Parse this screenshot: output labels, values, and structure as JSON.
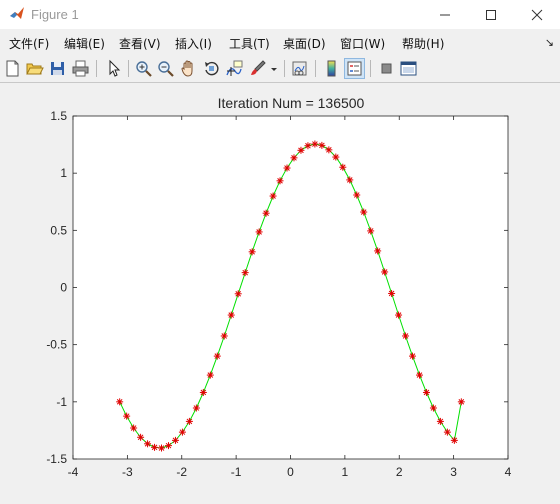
{
  "window": {
    "title": "Figure 1",
    "controls": [
      "minimize",
      "maximize",
      "close"
    ]
  },
  "menu": {
    "items": [
      "文件(F)",
      "编辑(E)",
      "查看(V)",
      "插入(I)",
      "工具(T)",
      "桌面(D)",
      "窗口(W)",
      "帮助(H)"
    ],
    "extra": "↘"
  },
  "toolbar": {
    "buttons": [
      "new-figure-icon",
      "open-file-icon",
      "save-icon",
      "print-icon",
      "pointer-icon",
      "zoom-in-icon",
      "zoom-out-icon",
      "pan-hand-icon",
      "rotate-3d-icon",
      "data-cursor-icon",
      "brush-icon",
      "brush-dropdown-icon",
      "link-plot-icon",
      "colorbar-icon",
      "legend-icon",
      "hide-plot-tools-icon",
      "show-plot-tools-icon"
    ]
  },
  "colors": {
    "line": "#00e000",
    "marker": "#e00000",
    "axes_bg": "#ffffff",
    "figure_bg": "#f0f0f0"
  },
  "chart_data": {
    "type": "line",
    "title": "Iteration Num = 136500",
    "xlabel": "",
    "ylabel": "",
    "xlim": [
      -4,
      4
    ],
    "ylim": [
      -1.5,
      1.5
    ],
    "xticks": [
      -4,
      -3,
      -2,
      -1,
      0,
      1,
      2,
      3,
      4
    ],
    "yticks": [
      -1.5,
      -1,
      -0.5,
      0,
      0.5,
      1,
      1.5
    ],
    "xtick_labels": [
      "-4",
      "-3",
      "-2",
      "-1",
      "0",
      "1",
      "2",
      "3",
      "4"
    ],
    "ytick_labels": [
      "-1.5",
      "-1",
      "-0.5",
      "0",
      "0.5",
      "1",
      "1.5"
    ],
    "grid": false,
    "series": [
      {
        "style": "line-green-with-red-asterisks",
        "x": [
          -3.1416,
          -3.0134,
          -2.8851,
          -2.7569,
          -2.6287,
          -2.5005,
          -2.3722,
          -2.244,
          -2.1158,
          -1.9875,
          -1.8593,
          -1.7311,
          -1.6029,
          -1.4746,
          -1.3464,
          -1.2182,
          -1.0899,
          -0.9617,
          -0.8335,
          -0.7053,
          -0.577,
          -0.4488,
          -0.3206,
          -0.1923,
          -0.0641,
          0.0641,
          0.1923,
          0.3206,
          0.4488,
          0.577,
          0.7053,
          0.8335,
          0.9617,
          1.0899,
          1.2182,
          1.3464,
          1.4746,
          1.6029,
          1.7311,
          1.8593,
          1.9875,
          2.1158,
          2.244,
          2.3722,
          2.5005,
          2.6287,
          2.7569,
          2.8851,
          3.0134,
          3.1416
        ],
        "y": [
          -1.0,
          -1.125,
          -1.229,
          -1.31,
          -1.367,
          -1.398,
          -1.404,
          -1.383,
          -1.337,
          -1.265,
          -1.171,
          -1.054,
          -0.918,
          -0.766,
          -0.6,
          -0.424,
          -0.241,
          -0.055,
          0.13,
          0.312,
          0.486,
          0.65,
          0.8,
          0.933,
          1.045,
          1.134,
          1.2,
          1.24,
          1.255,
          1.243,
          1.204,
          1.141,
          1.052,
          0.941,
          0.809,
          0.66,
          0.495,
          0.32,
          0.136,
          -0.052,
          -0.241,
          -0.424,
          -0.6,
          -0.766,
          -0.918,
          -1.054,
          -1.171,
          -1.265,
          -1.337,
          -1.0
        ]
      }
    ]
  }
}
